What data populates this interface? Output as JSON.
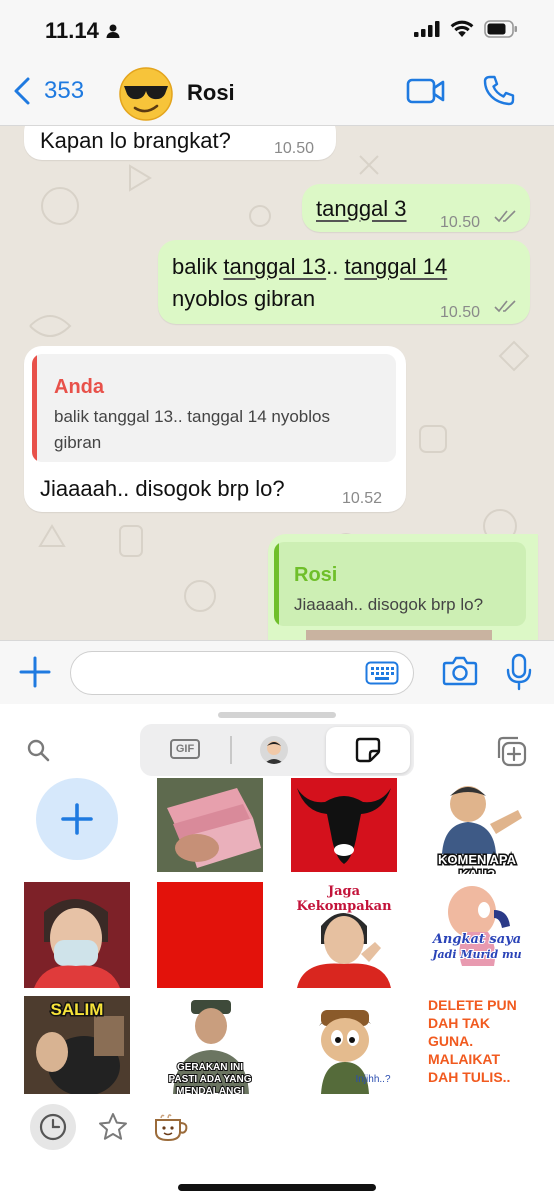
{
  "status_bar": {
    "time": "11.14"
  },
  "header": {
    "back_count": "353",
    "contact_name": "Rosi"
  },
  "messages": [
    {
      "text": "Kapan lo brangkat?",
      "time": "10.50"
    },
    {
      "text": "tanggal 3",
      "time": "10.50"
    },
    {
      "line1_a": "balik ",
      "line1_b": "tanggal 13",
      "line1_c": ".. ",
      "line1_d": "tanggal 14",
      "line2": "nyoblos gibran",
      "time": "10.50"
    },
    {
      "quote_name": "Anda",
      "quote_line1": "balik tanggal 13.. tanggal 14 nyoblos",
      "quote_line2": "gibran",
      "text": "Jiaaaah.. disogok brp lo?",
      "time": "10.52"
    },
    {
      "quote_name": "Rosi",
      "quote_text": "Jiaaaah.. disogok brp lo?"
    }
  ],
  "sticker_panel": {
    "gif_label": "GIF",
    "captions": {
      "komen": "KOMEN APA KAU?",
      "jaga": "Jaga Kekompakan",
      "angkat_1": "Angkat saya",
      "angkat_2": "Jadi Murid mu",
      "salim": "SALIM",
      "gerakan_1": "GERAKAN INI",
      "gerakan_2": "PASTI ADA YANG",
      "gerakan_3": "MENDALANGI",
      "injih": "Injihh..?",
      "delete_1": "DELETE PUN",
      "delete_2": "DAH TAK",
      "delete_3": "GUNA.",
      "delete_4": "MALAIKAT",
      "delete_5": "DAH TULIS.."
    }
  },
  "colors": {
    "accent": "#1f7ae0",
    "outgoing": "#dcf8c6",
    "incoming": "#ffffff",
    "quote_you": "#e8514a",
    "quote_contact": "#6fbf2a"
  }
}
